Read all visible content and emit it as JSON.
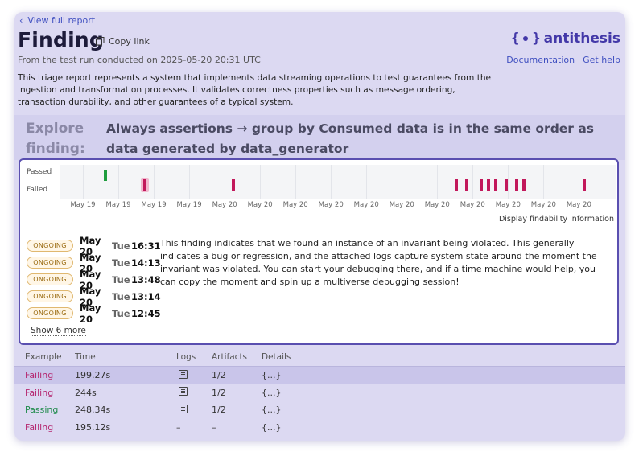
{
  "header": {
    "back_label": "View full report",
    "title": "Finding",
    "copy_label": "Copy link",
    "logo_text": "antithesis",
    "subtitle": "From the test run conducted on 2025-05-20 20:31 UTC",
    "links": [
      "Documentation",
      "Get help"
    ],
    "description": "This triage report represents a system that implements data streaming operations to test guarantees from the ingestion and transformation processes. It validates correctness properties such as message ordering, transaction durability, and other guarantees of a typical system."
  },
  "explore": {
    "label": "Explore finding:",
    "text": "Always assertions → group by Consumed data is in the same order as data generated by data_generator"
  },
  "chart_data": {
    "type": "scatter",
    "ylabels": [
      "Passed",
      "Failed"
    ],
    "xticks": [
      "May 19",
      "May 19",
      "May 19",
      "May 19",
      "May 20",
      "May 20",
      "May 20",
      "May 20",
      "May 20",
      "May 20",
      "May 20",
      "May 20",
      "May 20",
      "May 20",
      "May 20"
    ],
    "passed_x": [
      1.1
    ],
    "failed_x": [
      2.2,
      4.7,
      11.0,
      11.3,
      11.7,
      11.9,
      12.1,
      12.4,
      12.7,
      12.9,
      14.6
    ],
    "highlighted_x": 2.2,
    "xlim": [
      0,
      15.4
    ],
    "grid": true
  },
  "findability_label": "Display findability information",
  "events": [
    {
      "status": "ONGOING",
      "date": "May 20",
      "dow": "Tue",
      "time": "16:31"
    },
    {
      "status": "ONGOING",
      "date": "May 20",
      "dow": "Tue",
      "time": "14:13"
    },
    {
      "status": "ONGOING",
      "date": "May 20",
      "dow": "Tue",
      "time": "13:48"
    },
    {
      "status": "ONGOING",
      "date": "May 20",
      "dow": "Tue",
      "time": "13:14"
    },
    {
      "status": "ONGOING",
      "date": "May 20",
      "dow": "Tue",
      "time": "12:45"
    }
  ],
  "show_more_label": "Show 6 more",
  "finding_text": "This finding indicates that we found an instance of an invariant being violated. This generally indicates a bug or regression, and the attached logs capture system state around the moment the invariant was violated. You can start your debugging there, and if a time machine would help, you can copy the moment and spin up a multiverse debugging session!",
  "table": {
    "headers": [
      "Example",
      "Time",
      "Logs",
      "Artifacts",
      "Details"
    ],
    "rows": [
      {
        "example": "Failing",
        "time": "199.27s",
        "logs": "icon",
        "artifacts": "1/2",
        "details": "{...}"
      },
      {
        "example": "Failing",
        "time": "244s",
        "logs": "icon",
        "artifacts": "1/2",
        "details": "{...}"
      },
      {
        "example": "Passing",
        "time": "248.34s",
        "logs": "icon",
        "artifacts": "1/2",
        "details": "{...}"
      },
      {
        "example": "Failing",
        "time": "195.12s",
        "logs": "–",
        "artifacts": "–",
        "details": "{...}"
      }
    ]
  },
  "colors": {
    "accent": "#3f4fc0",
    "passed": "#1f9d3e",
    "failed": "#c2185b",
    "card": "#dcd9f2"
  }
}
